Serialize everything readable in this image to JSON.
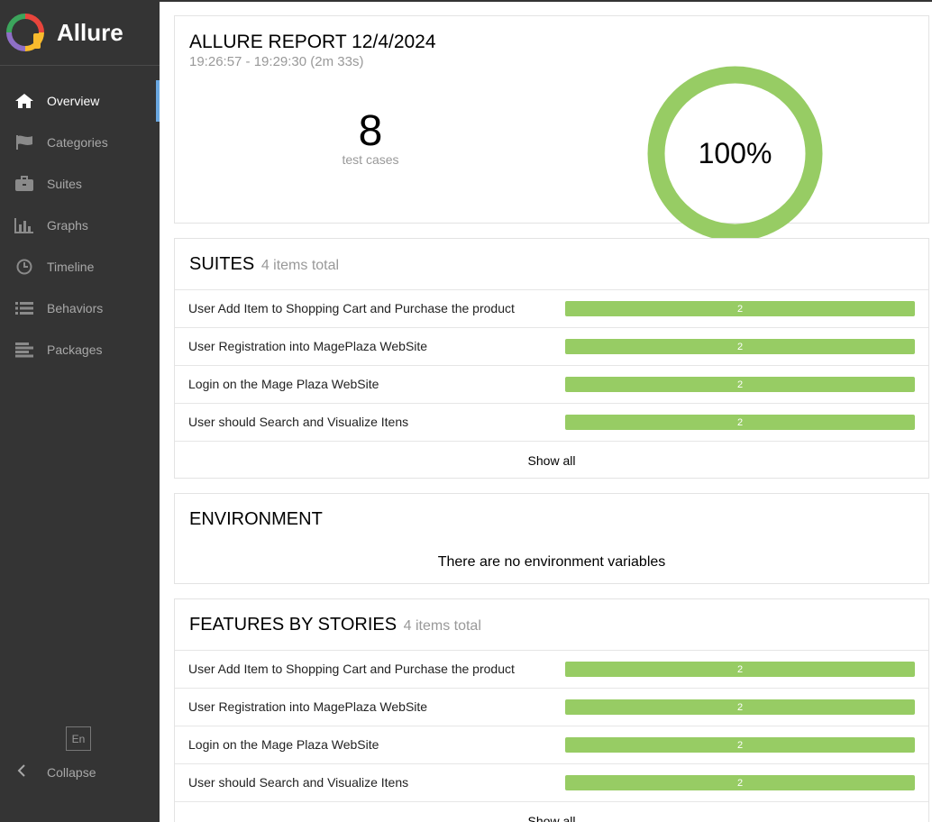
{
  "brand": {
    "name": "Allure"
  },
  "sidebar": {
    "items": [
      {
        "label": "Overview",
        "icon": "home-icon",
        "active": true
      },
      {
        "label": "Categories",
        "icon": "flag-icon"
      },
      {
        "label": "Suites",
        "icon": "briefcase-icon"
      },
      {
        "label": "Graphs",
        "icon": "bar-chart-icon"
      },
      {
        "label": "Timeline",
        "icon": "clock-icon"
      },
      {
        "label": "Behaviors",
        "icon": "list-icon"
      },
      {
        "label": "Packages",
        "icon": "align-left-icon"
      }
    ],
    "language": "En",
    "collapse_label": "Collapse"
  },
  "summary": {
    "title": "ALLURE REPORT 12/4/2024",
    "time": "19:26:57 - 19:29:30 (2m 33s)",
    "test_count": "8",
    "test_count_label": "test cases",
    "pass_rate": "100%",
    "pass_color": "#97cc64"
  },
  "suites": {
    "title": "SUITES",
    "total": "4 items total",
    "rows": [
      {
        "label": "User Add Item to Shopping Cart and Purchase the product",
        "passed": "2"
      },
      {
        "label": "User Registration into MagePlaza WebSite",
        "passed": "2"
      },
      {
        "label": "Login on the Mage Plaza WebSite",
        "passed": "2"
      },
      {
        "label": "User should Search and Visualize Itens",
        "passed": "2"
      }
    ],
    "show_all": "Show all"
  },
  "environment": {
    "title": "ENVIRONMENT",
    "message": "There are no environment variables"
  },
  "features": {
    "title": "FEATURES BY STORIES",
    "total": "4 items total",
    "rows": [
      {
        "label": "User Add Item to Shopping Cart and Purchase the product",
        "passed": "2"
      },
      {
        "label": "User Registration into MagePlaza WebSite",
        "passed": "2"
      },
      {
        "label": "Login on the Mage Plaza WebSite",
        "passed": "2"
      },
      {
        "label": "User should Search and Visualize Itens",
        "passed": "2"
      }
    ],
    "show_all": "Show all"
  }
}
